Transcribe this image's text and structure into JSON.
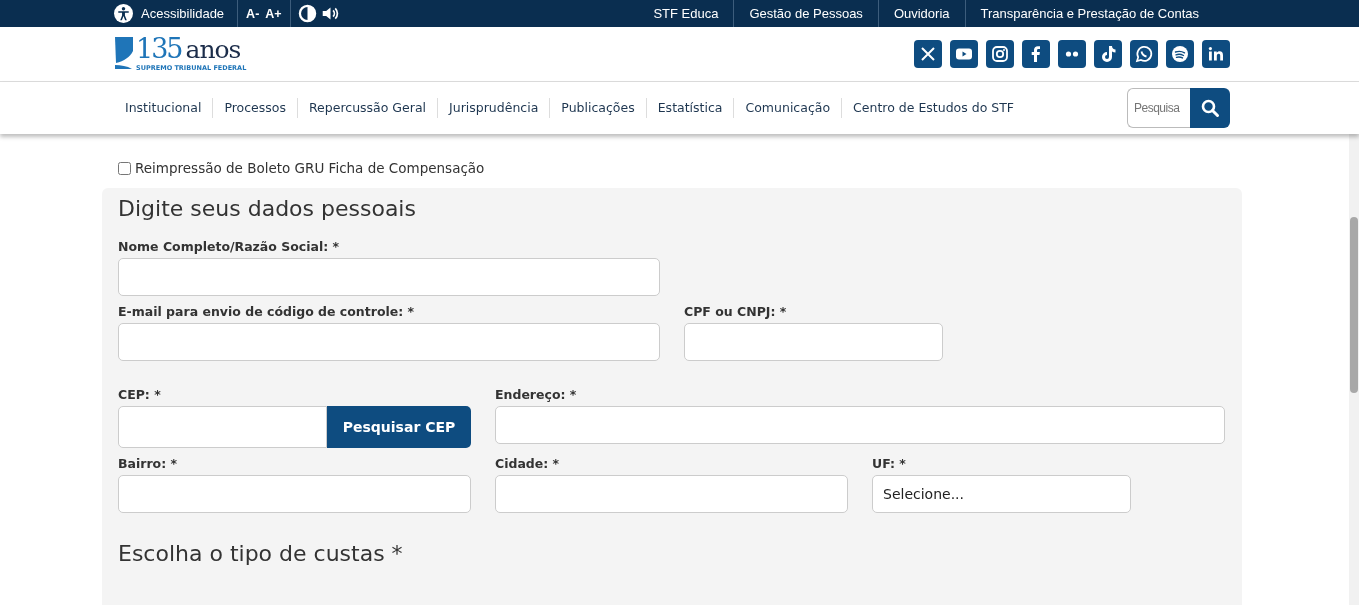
{
  "top_bar": {
    "accessibility": "Acessibilidade",
    "font_buttons": [
      "A-",
      "A+"
    ],
    "links": [
      "STF Educa",
      "Gestão de Pessoas",
      "Ouvidoria",
      "Transparência e Prestação de Contas"
    ]
  },
  "logo": {
    "number": "135",
    "word": "anos",
    "subtitle": "SUPREMO TRIBUNAL FEDERAL"
  },
  "social": [
    {
      "kind": "x"
    },
    {
      "kind": "youtube"
    },
    {
      "kind": "instagram"
    },
    {
      "kind": "facebook"
    },
    {
      "kind": "flickr"
    },
    {
      "kind": "tiktok"
    },
    {
      "kind": "whatsapp"
    },
    {
      "kind": "spotify"
    },
    {
      "kind": "linkedin"
    }
  ],
  "nav": [
    "Institucional",
    "Processos",
    "Repercussão Geral",
    "Jurisprudência",
    "Publicações",
    "Estatística",
    "Comunicação",
    "Centro de Estudos do STF"
  ],
  "search": {
    "placeholder": "Pesquisa"
  },
  "checkbox": {
    "label": "Reimpressão de Boleto GRU Ficha de Compensação",
    "checked": false
  },
  "form": {
    "title": "Digite seus dados pessoais",
    "rows": [
      [
        {
          "label": "Nome Completo/Razão Social: *",
          "kind": "input"
        }
      ],
      [
        {
          "label": "E-mail para envio de código de controle: *",
          "kind": "input"
        },
        {
          "label": "CPF ou CNPJ: *",
          "kind": "input"
        }
      ],
      [
        {
          "label": "CEP: *",
          "kind": "cep",
          "button": "Pesquisar CEP"
        },
        {
          "label": "Endereço: *",
          "kind": "input"
        }
      ],
      [
        {
          "label": "Bairro: *",
          "kind": "input"
        },
        {
          "label": "Cidade: *",
          "kind": "input"
        },
        {
          "label": "UF: *",
          "kind": "select",
          "value": "Selecione..."
        }
      ]
    ]
  },
  "section_title": "Escolha o tipo de custas *"
}
